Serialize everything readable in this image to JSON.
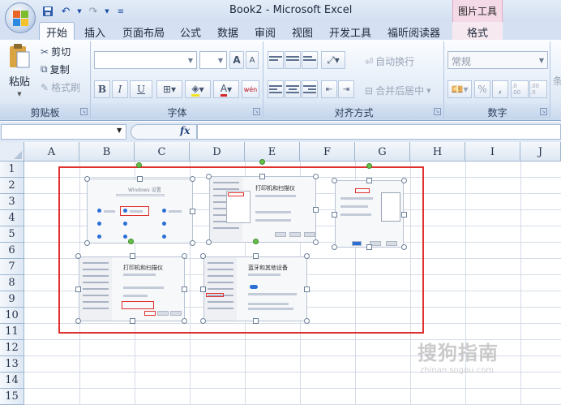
{
  "window": {
    "title": "Book2 - Microsoft Excel",
    "context_tab_group": "图片工具"
  },
  "quick_access": [
    "save-icon",
    "undo-icon",
    "redo-icon",
    "customize-icon"
  ],
  "tabs": [
    {
      "label": "开始",
      "active": true
    },
    {
      "label": "插入"
    },
    {
      "label": "页面布局"
    },
    {
      "label": "公式"
    },
    {
      "label": "数据"
    },
    {
      "label": "审阅"
    },
    {
      "label": "视图"
    },
    {
      "label": "开发工具"
    },
    {
      "label": "福昕阅读器"
    },
    {
      "label": "格式",
      "context": true
    }
  ],
  "ribbon": {
    "clipboard": {
      "label": "剪贴板",
      "paste": "粘贴",
      "cut": "剪切",
      "copy": "复制",
      "format_painter": "格式刷"
    },
    "font": {
      "label": "字体",
      "bold": "B",
      "italic": "I",
      "underline": "U",
      "grow": "A",
      "shrink": "A",
      "phonetic": "wén"
    },
    "alignment": {
      "label": "对齐方式",
      "wrap_text": "自动换行",
      "merge_center": "合并后居中"
    },
    "number": {
      "label": "数字",
      "format_value": "常规",
      "percent": "%",
      "comma": ",",
      "inc_decimal": ".0 .00",
      "dec_decimal": ".00 .0"
    },
    "styles_cut": "条"
  },
  "formula_bar": {
    "name_box": "",
    "fx": "fx",
    "formula": ""
  },
  "columns": [
    "A",
    "B",
    "C",
    "D",
    "E",
    "F",
    "G",
    "H",
    "I",
    "J"
  ],
  "rows": [
    "1",
    "2",
    "3",
    "4",
    "5",
    "6",
    "7",
    "8",
    "9",
    "10",
    "11",
    "12",
    "13",
    "14",
    "15"
  ],
  "screenshots": [
    {
      "heading": "Windows 设置"
    },
    {
      "heading": "打印机和扫描仪"
    },
    {
      "heading": ""
    },
    {
      "heading": "打印机和扫描仪"
    },
    {
      "heading": "蓝牙和其他设备"
    }
  ],
  "watermark": {
    "text": "搜狗指南",
    "sub": "zhinan.sogou.com"
  },
  "colors": {
    "accent": "#2b579a",
    "frame": "#e0312f",
    "context": "#f4d9e6"
  }
}
